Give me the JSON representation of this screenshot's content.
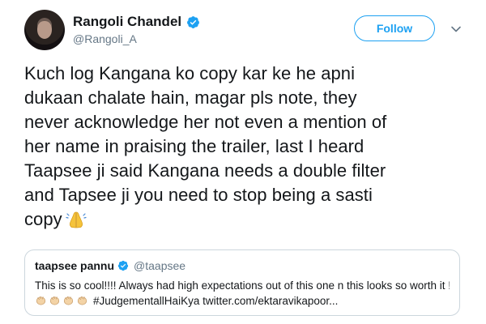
{
  "author": {
    "display_name": "Rangoli Chandel",
    "handle": "@Rangoli_A",
    "verified": true
  },
  "actions": {
    "follow_label": "Follow",
    "more_icon": "chevron-down-icon"
  },
  "tweet": {
    "lines": [
      "Kuch log Kangana ko copy kar ke he apni",
      "dukaan chalate hain, magar pls note, they",
      "never acknowledge her not even a mention of",
      "her name in praising the trailer, last I heard",
      "Taapsee ji said Kangana needs a double filter",
      "and Tapsee ji you need to stop being a sasti",
      "copy"
    ],
    "trailing_emoji": "folded-hands-icon"
  },
  "quoted_tweet": {
    "display_name": "taapsee pannu",
    "handle": "@taapsee",
    "verified": true,
    "line1": "This is so cool!!!! Always had high expectations out of this one n this looks so worth it !",
    "emoji_icon": "clapping-hands-icon",
    "emoji_count": 4,
    "line2_text": "#JudgementallHaiKya twitter.com/ektaravikapoor..."
  },
  "colors": {
    "accent": "#1da1f2",
    "text": "#14171a",
    "secondary": "#657786",
    "border": "#ccd6dd"
  }
}
